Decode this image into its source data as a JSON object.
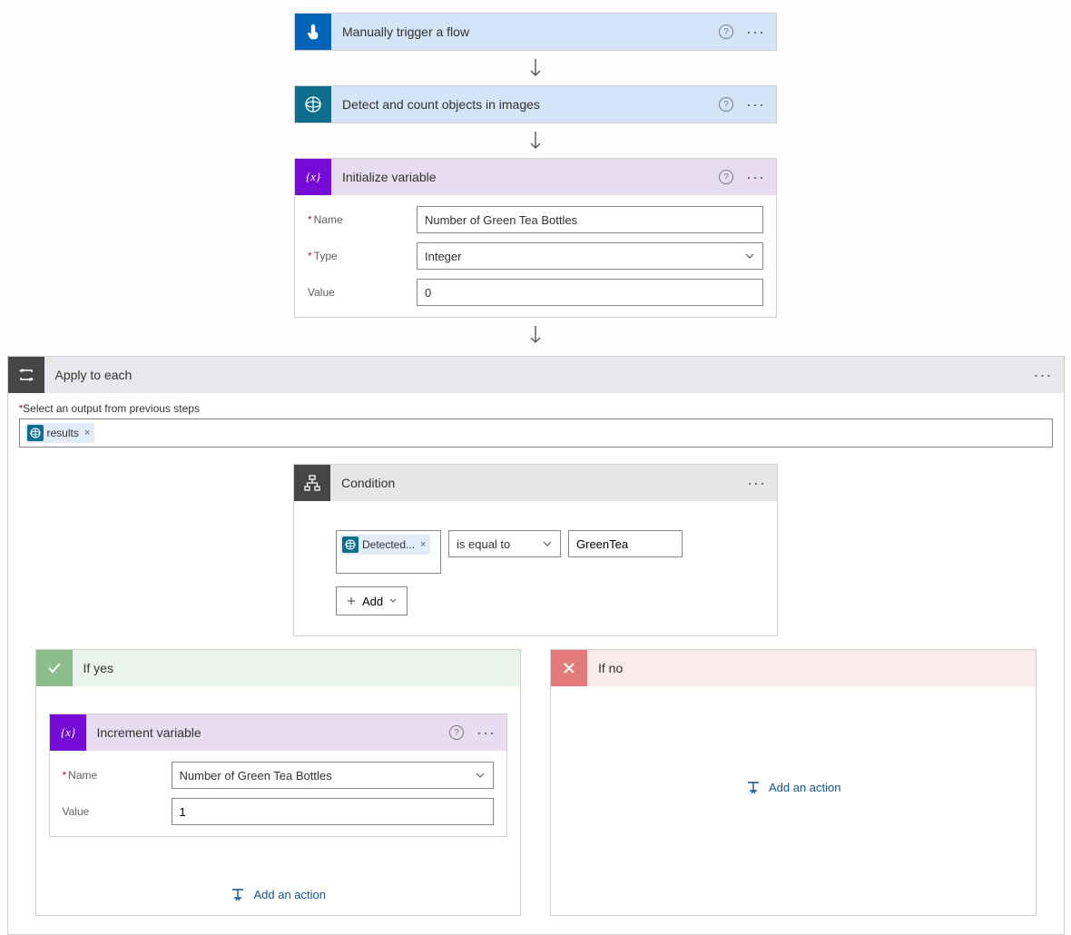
{
  "trigger": {
    "title": "Manually trigger a flow"
  },
  "ai_action": {
    "title": "Detect and count objects in images"
  },
  "init_variable": {
    "title": "Initialize variable",
    "fields": {
      "name_label": "Name",
      "name_value": "Number of Green Tea Bottles",
      "type_label": "Type",
      "type_value": "Integer",
      "value_label": "Value",
      "value_value": "0"
    }
  },
  "apply_to_each": {
    "title": "Apply to each",
    "output_label": "Select an output from previous steps",
    "token": "results"
  },
  "condition": {
    "title": "Condition",
    "left_token": "Detected...",
    "operator": "is equal to",
    "right_value": "GreenTea",
    "add_label": "Add"
  },
  "branches": {
    "yes": {
      "title": "If yes",
      "increment": {
        "title": "Increment variable",
        "name_label": "Name",
        "name_value": "Number of Green Tea Bottles",
        "value_label": "Value",
        "value_value": "1"
      },
      "add_action": "Add an action"
    },
    "no": {
      "title": "If no",
      "add_action": "Add an action"
    }
  }
}
